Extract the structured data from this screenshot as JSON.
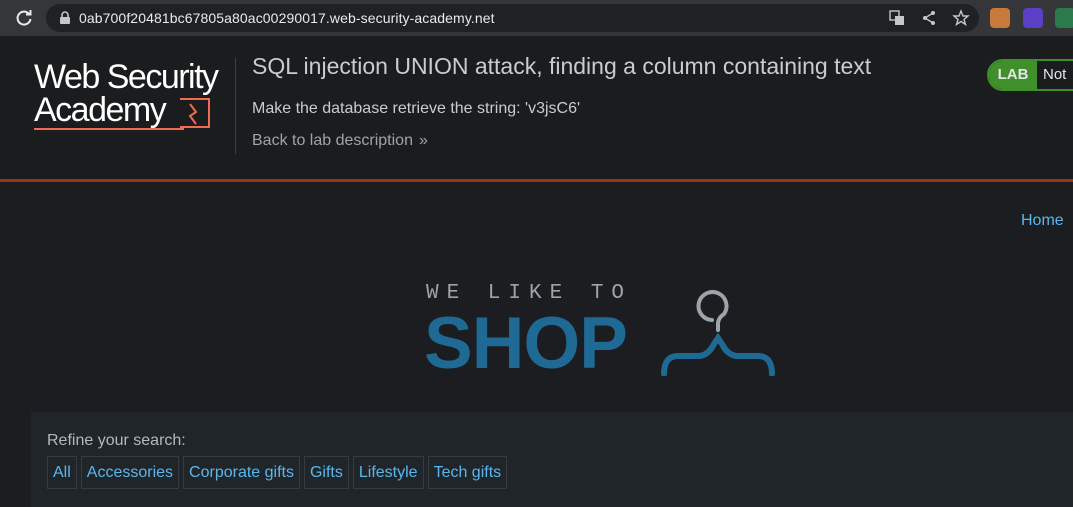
{
  "browser": {
    "url": "0ab700f20481bc67805a80ac00290017.web-security-academy.net",
    "icons": [
      "reload-icon",
      "lock-icon",
      "translate-icon",
      "share-icon",
      "star-icon",
      "extension-icon"
    ]
  },
  "lab_header": {
    "logo_line1": "Web Security",
    "logo_line2": "Academy",
    "title": "SQL injection UNION attack, finding a column containing text",
    "description": "Make the database retrieve the string: 'v3jsC6'",
    "back_link": "Back to lab description",
    "badge_label": "LAB",
    "badge_status": "Not",
    "accent_color": "#f06b4f",
    "badge_color": "#3f8f2b"
  },
  "nav": {
    "home": "Home"
  },
  "shop_logo": {
    "tagline": "WE LIKE TO",
    "word": "SHOP",
    "brand_color": "#1f6a94"
  },
  "refine": {
    "label": "Refine your search:",
    "filters": [
      "All",
      "Accessories",
      "Corporate gifts",
      "Gifts",
      "Lifestyle",
      "Tech gifts"
    ]
  }
}
